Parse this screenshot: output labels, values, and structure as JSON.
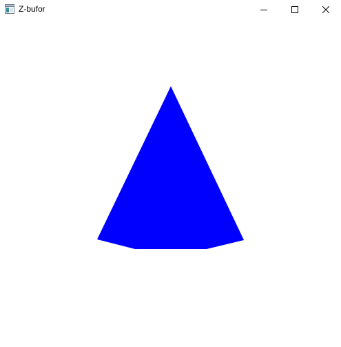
{
  "window": {
    "title": "Z-bufor",
    "icon": "app-window-icon",
    "controls": {
      "minimize_icon": "minimize-icon",
      "maximize_icon": "maximize-icon",
      "close_icon": "close-icon"
    }
  },
  "scene": {
    "background_color": "#ffffff",
    "shape": "cone",
    "fill_color": "#0000ff"
  }
}
